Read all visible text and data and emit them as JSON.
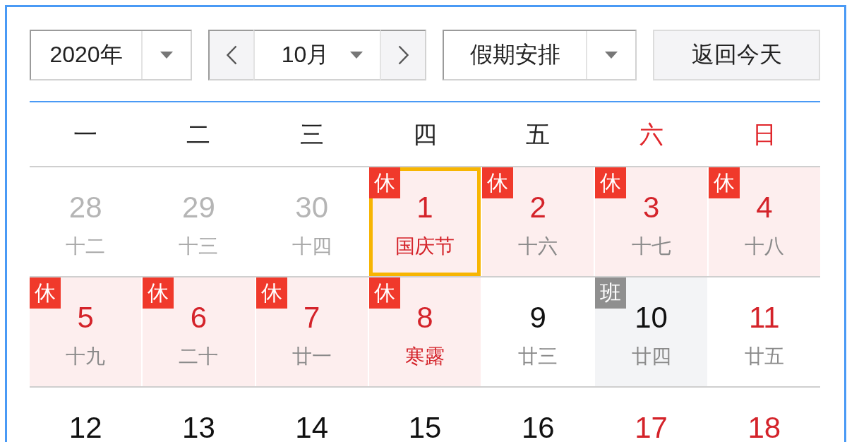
{
  "toolbar": {
    "year_select": {
      "value": "2020年"
    },
    "month_select": {
      "value": "10月"
    },
    "holiday_select": {
      "value": "假期安排"
    },
    "today_button": {
      "label": "返回今天"
    }
  },
  "weekdays": [
    {
      "label": "一",
      "weekend": false
    },
    {
      "label": "二",
      "weekend": false
    },
    {
      "label": "三",
      "weekend": false
    },
    {
      "label": "四",
      "weekend": false
    },
    {
      "label": "五",
      "weekend": false
    },
    {
      "label": "六",
      "weekend": true
    },
    {
      "label": "日",
      "weekend": true
    }
  ],
  "weeks": [
    {
      "days": [
        {
          "date": "28",
          "lunar": "十二",
          "other_month": true,
          "rest": false,
          "festival": false,
          "selected": false
        },
        {
          "date": "29",
          "lunar": "十三",
          "other_month": true,
          "rest": false,
          "festival": false,
          "selected": false
        },
        {
          "date": "30",
          "lunar": "十四",
          "other_month": true,
          "rest": false,
          "festival": false,
          "selected": false
        },
        {
          "date": "1",
          "lunar": "国庆节",
          "other_month": false,
          "rest": true,
          "festival": true,
          "selected": true,
          "badge": {
            "kind": "rest",
            "label": "休"
          }
        },
        {
          "date": "2",
          "lunar": "十六",
          "other_month": false,
          "rest": true,
          "festival": false,
          "selected": false,
          "badge": {
            "kind": "rest",
            "label": "休"
          }
        },
        {
          "date": "3",
          "lunar": "十七",
          "other_month": false,
          "rest": true,
          "festival": false,
          "selected": false,
          "badge": {
            "kind": "rest",
            "label": "休"
          }
        },
        {
          "date": "4",
          "lunar": "十八",
          "other_month": false,
          "rest": true,
          "festival": false,
          "selected": false,
          "badge": {
            "kind": "rest",
            "label": "休"
          }
        }
      ]
    },
    {
      "days": [
        {
          "date": "5",
          "lunar": "十九",
          "other_month": false,
          "rest": true,
          "festival": false,
          "selected": false,
          "badge": {
            "kind": "rest",
            "label": "休"
          }
        },
        {
          "date": "6",
          "lunar": "二十",
          "other_month": false,
          "rest": true,
          "festival": false,
          "selected": false,
          "badge": {
            "kind": "rest",
            "label": "休"
          }
        },
        {
          "date": "7",
          "lunar": "廿一",
          "other_month": false,
          "rest": true,
          "festival": false,
          "selected": false,
          "badge": {
            "kind": "rest",
            "label": "休"
          }
        },
        {
          "date": "8",
          "lunar": "寒露",
          "other_month": false,
          "rest": true,
          "festival": true,
          "selected": false,
          "badge": {
            "kind": "rest",
            "label": "休"
          }
        },
        {
          "date": "9",
          "lunar": "廿三",
          "other_month": false,
          "rest": false,
          "festival": false,
          "selected": false
        },
        {
          "date": "10",
          "lunar": "廿四",
          "other_month": false,
          "rest": false,
          "festival": false,
          "selected": false,
          "badge": {
            "kind": "work",
            "label": "班"
          }
        },
        {
          "date": "11",
          "lunar": "廿五",
          "other_month": false,
          "rest": true,
          "festival": false,
          "selected": false
        }
      ]
    },
    {
      "days": [
        {
          "date": "12",
          "other_month": false,
          "rest": false,
          "selected": false
        },
        {
          "date": "13",
          "other_month": false,
          "rest": false,
          "selected": false
        },
        {
          "date": "14",
          "other_month": false,
          "rest": false,
          "selected": false
        },
        {
          "date": "15",
          "other_month": false,
          "rest": false,
          "selected": false
        },
        {
          "date": "16",
          "other_month": false,
          "rest": false,
          "selected": false
        },
        {
          "date": "17",
          "other_month": false,
          "rest": true,
          "selected": false
        },
        {
          "date": "18",
          "other_month": false,
          "rest": true,
          "selected": false
        }
      ]
    }
  ]
}
